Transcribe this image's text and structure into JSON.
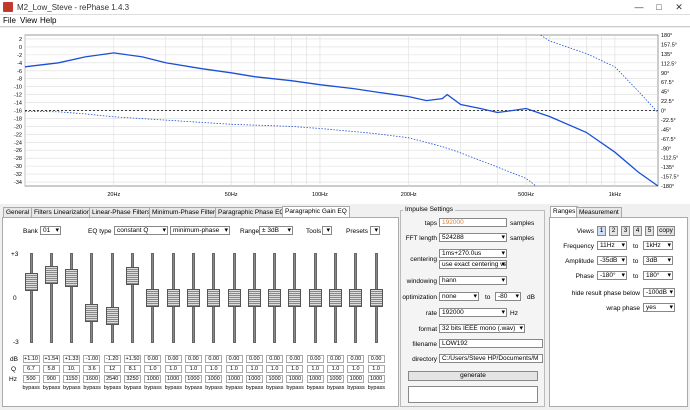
{
  "window": {
    "title": "M2_Low_Steve  -  rePhase 1.4.3",
    "menu": [
      "File",
      "View",
      "Help"
    ],
    "minimize": "—",
    "maximize": "□",
    "close": "✕"
  },
  "colors": {
    "curve": "#1b4fd8",
    "grid": "#dcdcdc",
    "window_bg": "#f0f0f0"
  },
  "chart_data": {
    "type": "line",
    "x_scale": "log",
    "x_ticks": [
      "20Hz",
      "50Hz",
      "100Hz",
      "200Hz",
      "500Hz",
      "1kHz"
    ],
    "x_tick_values": [
      20,
      50,
      100,
      200,
      500,
      1000
    ],
    "xlim": [
      10,
      1400
    ],
    "y_left_ticks": [
      "2",
      "0",
      "-2",
      "-4",
      "-6",
      "-8",
      "-10",
      "-12",
      "-14",
      "-16",
      "-18",
      "-20",
      "-22",
      "-24",
      "-26",
      "-28",
      "-30",
      "-32",
      "-34"
    ],
    "ylim_left": [
      -35,
      3
    ],
    "y_right_ticks": [
      "180°",
      "157.5°",
      "135°",
      "112.5°",
      "90°",
      "67.5°",
      "45°",
      "22.5°",
      "0°",
      "-22.5°",
      "-45°",
      "-67.5°",
      "-90°",
      "-112.5°",
      "-135°",
      "-157.5°",
      "-180°"
    ],
    "ylim_right": [
      -180,
      180
    ],
    "grid": true,
    "series": [
      {
        "style": "solid",
        "axis": "left",
        "x": [
          10,
          13,
          16,
          20,
          25,
          30,
          40,
          50,
          60,
          80,
          100,
          130,
          160,
          200,
          230,
          260,
          270,
          300,
          350,
          400,
          450,
          500,
          600,
          800,
          1000,
          1200,
          1400
        ],
        "y": [
          -5,
          -4,
          -2.5,
          -1.5,
          -2.5,
          -4,
          -5.5,
          -6.5,
          -7.5,
          -8.5,
          -9.5,
          -10.5,
          -11.5,
          -12.5,
          -13.5,
          -13,
          -12,
          -14.5,
          -15.5,
          -16.5,
          -16,
          -15.5,
          -17.5,
          -21.5,
          -26.5,
          -31.5,
          -35
        ]
      },
      {
        "style": "dotted",
        "axis": "right",
        "x": [
          10,
          13,
          16,
          20,
          30,
          50,
          80,
          100,
          150,
          200,
          260,
          300,
          400,
          500,
          540,
          560,
          600,
          800,
          1000,
          1200,
          1400
        ],
        "y": [
          -2,
          -3,
          -8,
          -15,
          -23,
          -33,
          -38,
          -43,
          -54,
          -65,
          -86,
          -101,
          -135,
          -162,
          -180,
          180,
          166,
          136,
          104,
          46,
          -5
        ]
      }
    ]
  },
  "tabs": [
    "General",
    "Filters Linearization",
    "Linear-Phase Filters",
    "Minimum-Phase Filters",
    "Paragraphic Phase EQ",
    "Paragraphic Gain EQ"
  ],
  "eq": {
    "bank_label": "Bank",
    "bank": "01",
    "eqtype_label": "EQ type",
    "eqtype": "constant Q",
    "phase_mode": "minimum-phase",
    "range_label": "Range",
    "range": "± 3dB",
    "tools_label": "Tools",
    "presets_label": "Presets",
    "scale_top": "+3",
    "scale_mid": "0",
    "scale_bot": "-3",
    "row_db": "dB",
    "row_q": "Q",
    "row_hz": "Hz",
    "bypass_label": "bypass",
    "bands": [
      {
        "gain": 1.1,
        "db": "+1.10",
        "q": "6.7",
        "hz": "500"
      },
      {
        "gain": 1.54,
        "db": "+1.54",
        "q": "5.8",
        "hz": "900"
      },
      {
        "gain": 1.33,
        "db": "+1.33",
        "q": "10.",
        "hz": "1150"
      },
      {
        "gain": -1.0,
        "db": "-1.00",
        "q": "3.6",
        "hz": "1600"
      },
      {
        "gain": -1.2,
        "db": "-1.20",
        "q": "12",
        "hz": "2540"
      },
      {
        "gain": 1.5,
        "db": "+1.50",
        "q": "8.1",
        "hz": "3250"
      },
      {
        "gain": 0,
        "db": "0.00",
        "q": "1.0",
        "hz": "1000"
      },
      {
        "gain": 0,
        "db": "0.00",
        "q": "1.0",
        "hz": "1000"
      },
      {
        "gain": 0,
        "db": "0.00",
        "q": "1.0",
        "hz": "1000"
      },
      {
        "gain": 0,
        "db": "0.00",
        "q": "1.0",
        "hz": "1000"
      },
      {
        "gain": 0,
        "db": "0.00",
        "q": "1.0",
        "hz": "1000"
      },
      {
        "gain": 0,
        "db": "0.00",
        "q": "1.0",
        "hz": "1000"
      },
      {
        "gain": 0,
        "db": "0.00",
        "q": "1.0",
        "hz": "1000"
      },
      {
        "gain": 0,
        "db": "0.00",
        "q": "1.0",
        "hz": "1000"
      },
      {
        "gain": 0,
        "db": "0.00",
        "q": "1.0",
        "hz": "1000"
      },
      {
        "gain": 0,
        "db": "0.00",
        "q": "1.0",
        "hz": "1000"
      },
      {
        "gain": 0,
        "db": "0.00",
        "q": "1.0",
        "hz": "1000"
      },
      {
        "gain": 0,
        "db": "0.00",
        "q": "1.0",
        "hz": "1000"
      }
    ]
  },
  "impulse": {
    "title": "Impulse Settings",
    "taps_label": "taps",
    "taps": "192000",
    "taps_unit": "samples",
    "fft_label": "FFT length",
    "fft": "524288",
    "fft_unit": "samples",
    "centering_label": "centering",
    "centering": "1ms+270.0us",
    "centering_mode": "use exact centering value",
    "windowing_label": "windowing",
    "windowing": "hann",
    "optimization_label": "optimization",
    "optimization": "none",
    "opt_to": "to",
    "opt_db": "-80",
    "opt_unit": "dB",
    "rate_label": "rate",
    "rate": "192000",
    "rate_unit": "Hz",
    "format_label": "format",
    "format": "32 bits IEEE mono (.wav)",
    "filename_label": "filename",
    "filename": "LOW192",
    "directory_label": "directory",
    "directory": "C:/Users/Steve HP/Documents/M",
    "generate": "generate"
  },
  "ranges": {
    "tabs": [
      "Ranges",
      "Measurement"
    ],
    "views_label": "Views",
    "views": [
      "1",
      "2",
      "3",
      "4",
      "5"
    ],
    "copy": "copy",
    "frequency_label": "Frequency",
    "freq_from": "11Hz",
    "freq_to": "1kHz",
    "amplitude_label": "Amplitude",
    "amp_from": "-35dB",
    "amp_to": "3dB",
    "phase_label": "Phase",
    "phase_from": "-180°",
    "phase_to": "180°",
    "to": "to",
    "hide_label": "hide result phase below",
    "hide_value": "-100dB",
    "wrap_label": "wrap phase",
    "wrap_value": "yes"
  }
}
